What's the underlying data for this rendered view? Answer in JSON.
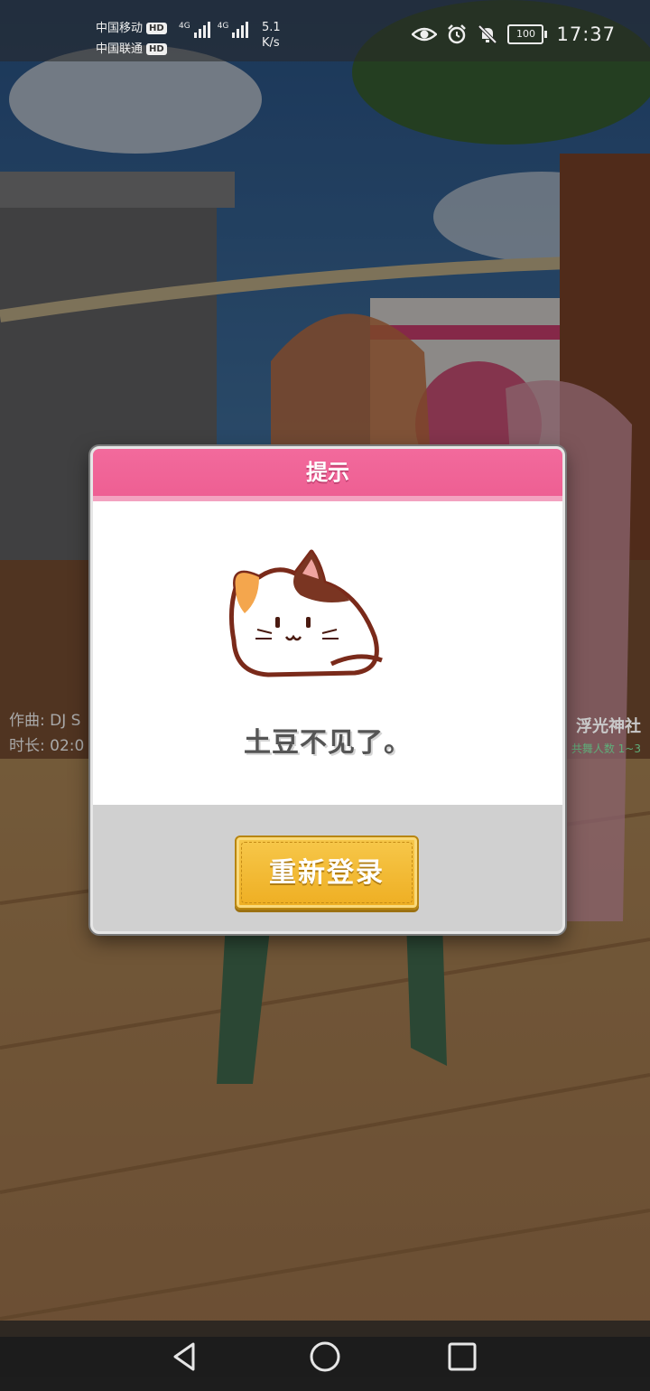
{
  "status_bar": {
    "carrier_1": "中国移动",
    "carrier_2": "中国联通",
    "hd_badge": "HD",
    "network_type": "4G",
    "net_speed_value": "5.1",
    "net_speed_unit": "K/s",
    "battery_level": "100",
    "time": "17:37",
    "icons": [
      "eye-icon",
      "alarm-icon",
      "mute-icon",
      "battery-icon"
    ]
  },
  "background_info": {
    "composer": "作曲: DJ S",
    "duration": "时长: 02:0",
    "stage_name": "浮光神社",
    "dancers": "共舞人数 1~3"
  },
  "dialog": {
    "title": "提示",
    "message": "土豆不见了。",
    "button_label": "重新登录"
  },
  "nav_bar": {
    "buttons": [
      "back-icon",
      "home-icon",
      "recents-icon"
    ]
  },
  "colors": {
    "header_pink": "#ee5f93",
    "button_gold": "#f0b32a",
    "dialog_footer_gray": "#d0d0d0"
  }
}
